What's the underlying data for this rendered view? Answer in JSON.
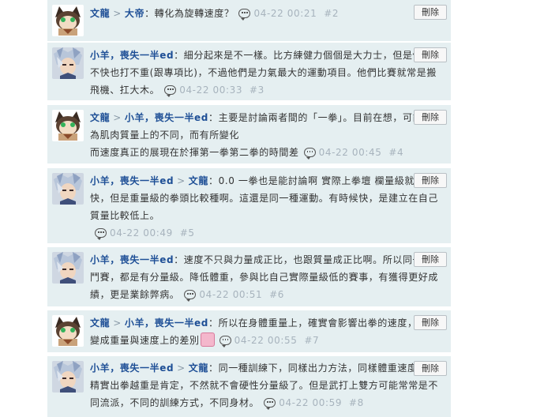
{
  "delete_label": "刪除",
  "sep": ">",
  "colors": {
    "card_bg": "#e5eff1",
    "username": "#1e4f96",
    "meta": "#a7b3bd"
  },
  "icons": {
    "reply": "speech-bubble-icon",
    "emoji": "emoticon-icon"
  },
  "comments": [
    {
      "avatar": "cat-avatar",
      "users": [
        "文龍",
        "大帝"
      ],
      "text": "：轉化為旋轉速度？",
      "time": "04-22 00:21",
      "num": "#2"
    },
    {
      "avatar": "silver-hair-avatar",
      "users": [
        "小羊，喪失一半ed"
      ],
      "text": "：細分起來是不一樣。比方練健力個個是大力士，但是他們跑不快也打不重(跟專項比)，不過他們是力氣最大的運動項目。他們比賽就常是搬飛機、扛大木。",
      "time": "04-22 00:33",
      "num": "#3"
    },
    {
      "avatar": "cat-avatar",
      "users": [
        "文龍",
        "小羊，喪失一半ed"
      ],
      "text_a": "：主要是討論兩者間的「一拳」。目前在想，可能會因為肌肉質量上的不同，而有所變化",
      "text_b": "而速度真正的展現在於揮第一拳第二拳的時間差",
      "time": "04-22 00:45",
      "num": "#4"
    },
    {
      "avatar": "silver-hair-avatar",
      "users": [
        "小羊，喪失一半ed",
        "文龍"
      ],
      "text": "：0.0 一拳也是能討論啊 實際上拳壇 欄量級就是比較快，但是重量級的拳頭比較種啊。這還是同一種運動。有時候快，是建立在自己質量比較低上。",
      "time": "04-22 00:49",
      "num": "#5"
    },
    {
      "avatar": "silver-hair-avatar",
      "users": [
        "小羊，喪失一半ed"
      ],
      "text": "：速度不只與力量成正比，也跟質量成正比啊。所以同一種格鬥賽，都是有分量級。降低體重，參與比自己實際量級低的賽事，有獲得更好成績，更是業餘弊病。",
      "time": "04-22 00:51",
      "num": "#6"
    },
    {
      "avatar": "cat-avatar",
      "users": [
        "文龍",
        "小羊，喪失一半ed"
      ],
      "text": "：所以在身體重量上，確實會影響出拳的速度，進而變成重量與速度上的差別",
      "time": "04-22 00:55",
      "num": "#7"
    },
    {
      "avatar": "silver-hair-avatar",
      "users": [
        "小羊，喪失一半ed",
        "文龍"
      ],
      "text": "：同一種訓練下，同樣出力方法，同樣體重速度，越精實出拳越重是肯定，不然就不會硬性分量級了。但是武打上雙方可能常常是不同流派，不同的訓練方式，不同身材。",
      "time": "04-22 00:59",
      "num": "#8"
    }
  ]
}
